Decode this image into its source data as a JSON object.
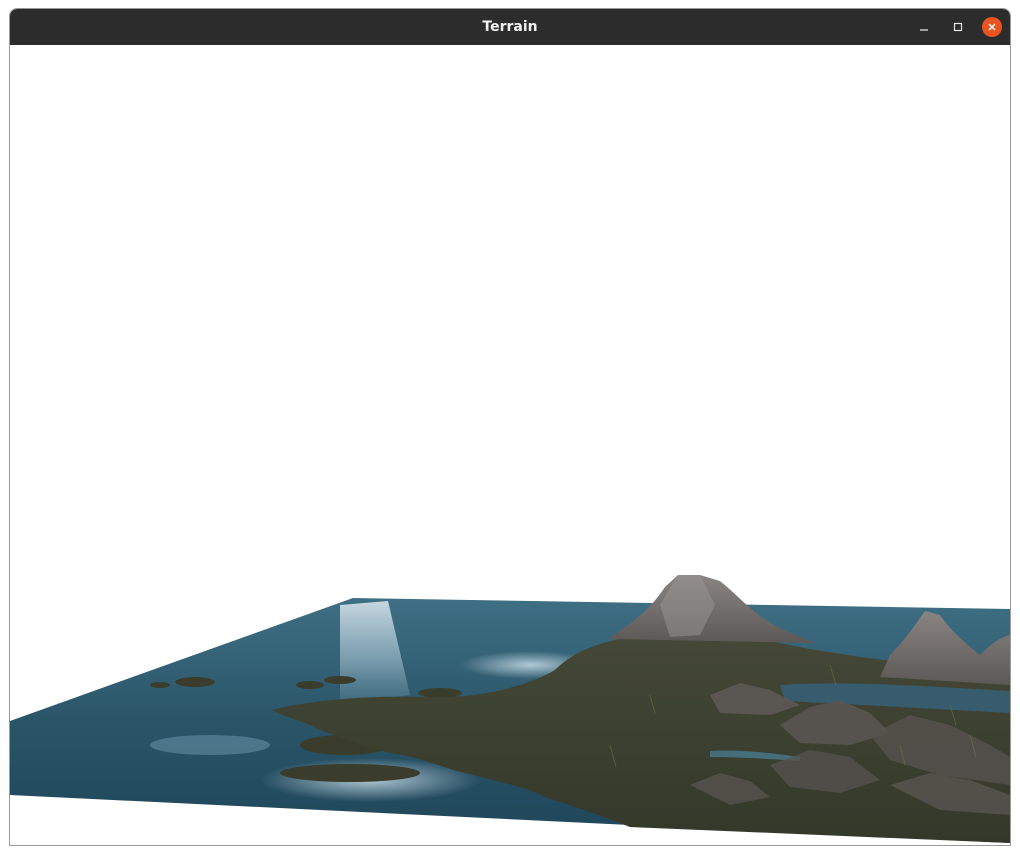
{
  "window": {
    "title": "Terrain",
    "controls": [
      "minimize",
      "maximize",
      "close"
    ],
    "close_button_color": "#e95420",
    "titlebar_color": "#2c2c2c"
  },
  "scene": {
    "background_color": "#ffffff",
    "water_color": "#2d5a70",
    "land_color": "#3a3f2a",
    "mountain_color": "#6b6866"
  }
}
